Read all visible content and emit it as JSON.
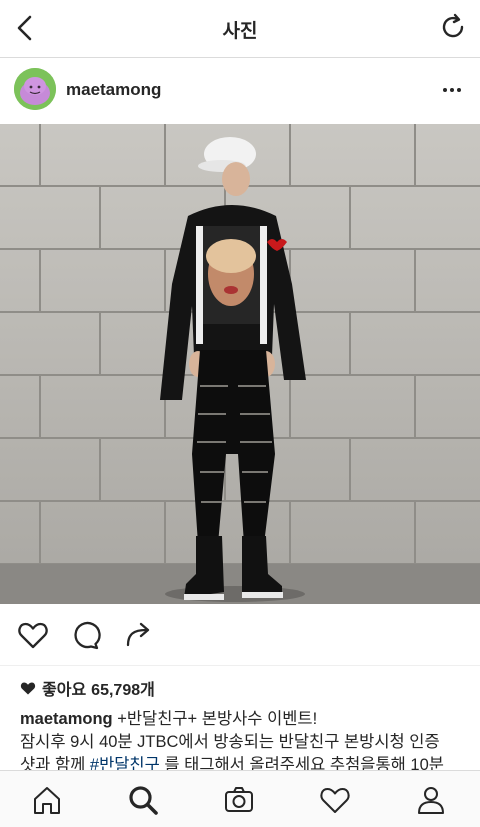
{
  "header": {
    "title": "사진"
  },
  "post": {
    "username": "maetamong",
    "likes_label": "좋아요",
    "likes_count": "65,798개",
    "caption": {
      "username": "maetamong",
      "line1_rest": " +반달친구+ 본방사수 이벤트!",
      "line2": "잠시후 9시 40분 JTBC에서 방송되는 반달친구 본방시청 인증",
      "line3_a": "샷과 함께 ",
      "line3_tag": "#반달친구",
      "line3_b": " 를 태그해서 올려주세요 추첨을통해 10분"
    }
  },
  "icons": {
    "back": "chevron-left-icon",
    "refresh": "refresh-icon",
    "more": "more-dots-icon",
    "like": "heart-outline-icon",
    "comment": "comment-icon",
    "share": "share-arrow-icon",
    "home": "home-icon",
    "search": "search-icon",
    "camera": "camera-icon",
    "activity": "heart-outline-icon",
    "profile": "profile-icon"
  },
  "colors": {
    "text": "#262626",
    "hashtag": "#003569",
    "border": "#dbdbdb",
    "background": "#ffffff"
  }
}
